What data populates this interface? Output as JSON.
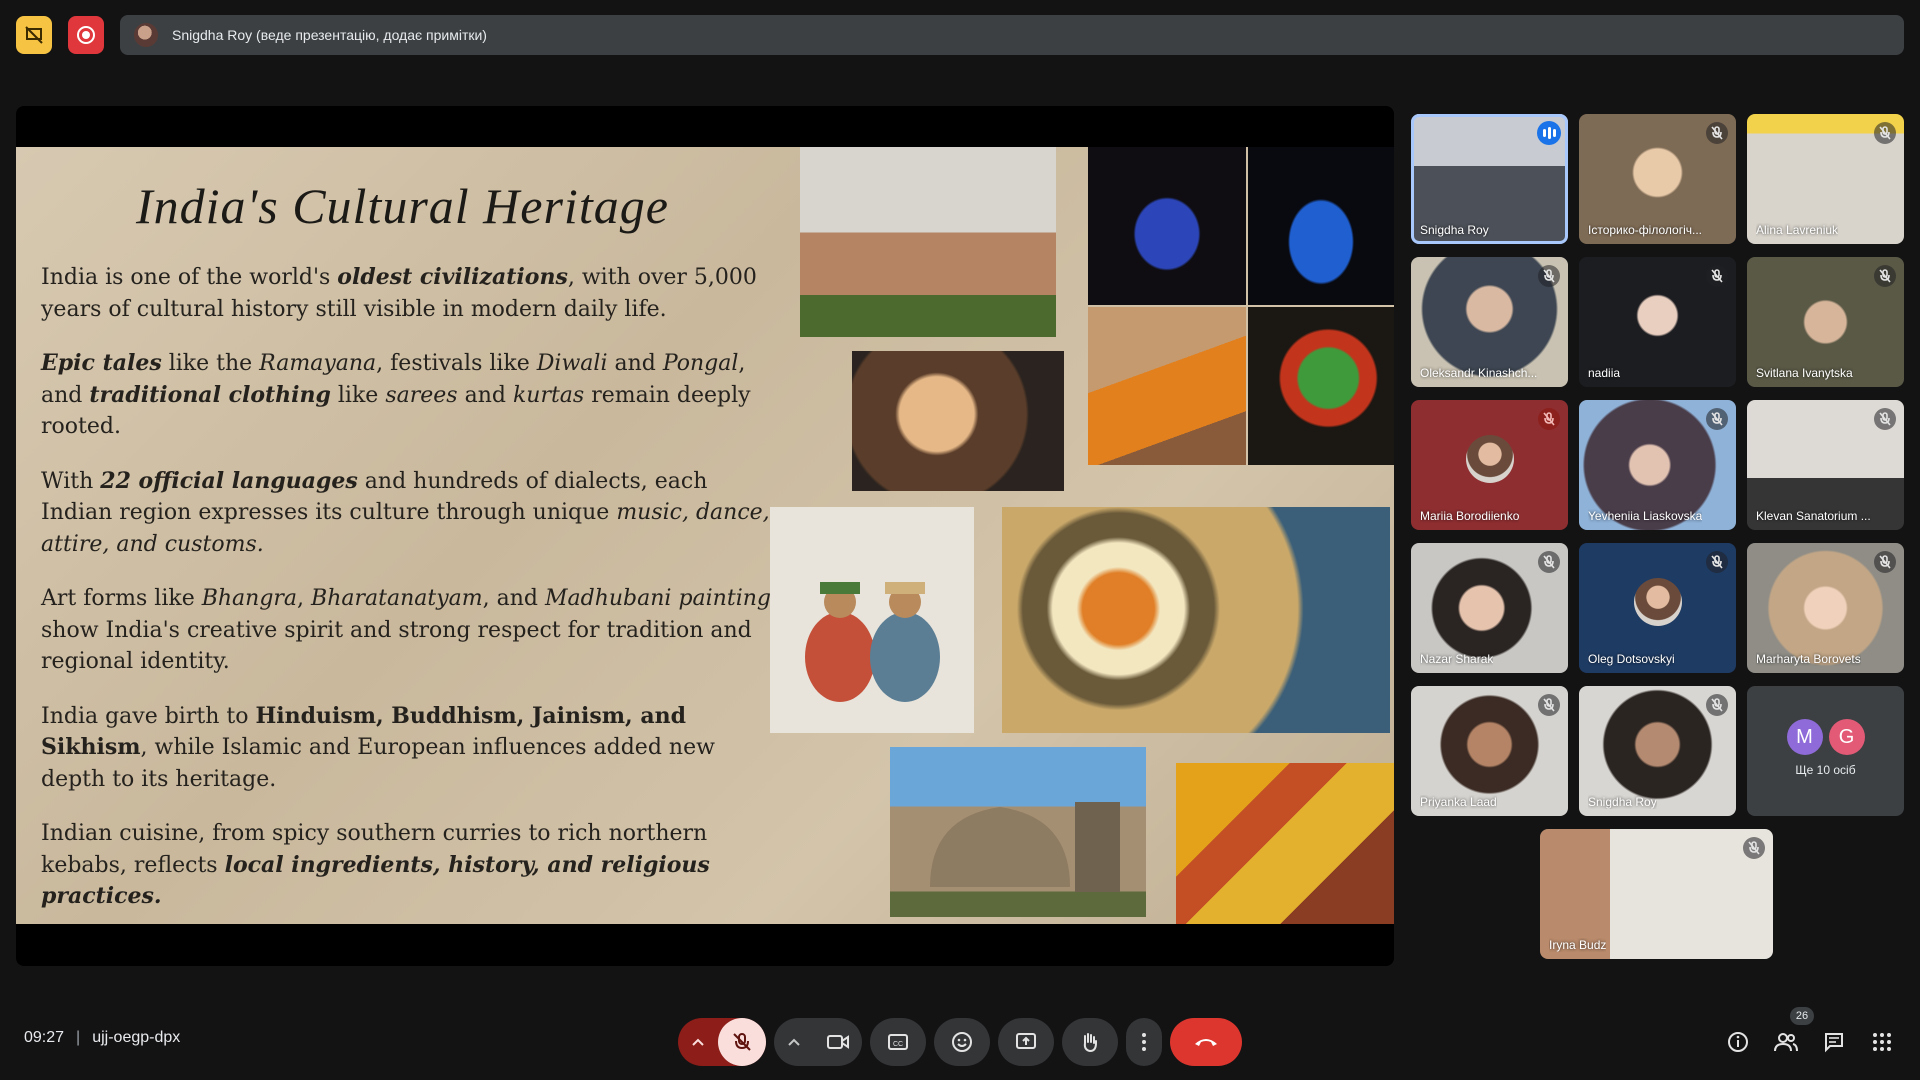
{
  "presenter_bar": {
    "text": "Snigdha Roy (веде презентацію, додає примітки)"
  },
  "slide": {
    "title": "India's Cultural Heritage",
    "paragraphs": [
      "India is one of the world's <i><b>oldest civilizations</b></i>, with over 5,000 years of cultural history still visible in modern daily life.",
      "<i><b>Epic tales</b></i> like the <i>Ramayana</i>, festivals like <i>Diwali</i> and <i>Pongal</i>, and <i><b>traditional clothing</b></i> like <i>sarees</i> and <i>kurtas</i> remain deeply rooted.",
      "With <i><b>22 official languages</b></i> and hundreds of dialects, each Indian region expresses its culture through unique <i>music, dance, attire, and customs.</i>",
      "Art forms like <i>Bhangra</i>, <i>Bharatanatyam</i>, and <i>Madhubani painting</i> show India's creative spirit and strong respect for tradition and regional identity.",
      "India gave birth to <b>Hinduism, Buddhism, Jainism, and Sikhism</b>, while Islamic and European influences added new depth to its heritage.",
      "Indian cuisine, from spicy southern curries to rich northern kebabs, reflects <i><b>local ingredients, history, and religious practices.</b></i>"
    ]
  },
  "participants": [
    {
      "name": "Snigdha Roy",
      "muted": false,
      "speaking": true,
      "bg": "linear-gradient(180deg,#c8ccd2 0 40%,#4c5058 40% 100%)"
    },
    {
      "name": "Історико-філологіч...",
      "muted": true,
      "bg": "radial-gradient(circle at 50% 45%,#e8c9a8 0 22%,#7e6b55 24% 100%)"
    },
    {
      "name": "Alina Lavreniuk",
      "muted": true,
      "bg": "linear-gradient(180deg,#f2d24a 0 15%,#d8d4cc 15% 100%)"
    },
    {
      "name": "Oleksandr Kinashch...",
      "muted": true,
      "bg": "radial-gradient(circle at 50% 40%,#d9b9a2 0 20%,#3d4652 22% 60%,#c9c2b2 62% 100%)"
    },
    {
      "name": "nadiia",
      "muted": true,
      "bg": "radial-gradient(circle at 50% 45%,#e9cfc0 0 18%,#1c1d21 20% 100%)"
    },
    {
      "name": "Svitlana Ivanytska",
      "muted": true,
      "bg": "radial-gradient(circle at 50% 50%,#d6b59a 0 20%,#5a5946 22% 100%)"
    },
    {
      "name": "Mariia Borodiienko",
      "muted": true,
      "muted_red": true,
      "avatar": true,
      "bg": "#8e2e31"
    },
    {
      "name": "Yevheniia Liaskovska",
      "muted": true,
      "bg": "radial-gradient(circle at 45% 50%,#e2c3b2 0 18%,#4a3d4a 20% 60%,#8fb2d8 62% 100%)"
    },
    {
      "name": "Klevan Sanatorium ...",
      "muted": true,
      "bg": "linear-gradient(180deg,#ddd9d4 0 60%,#363535 60% 100%)"
    },
    {
      "name": "Nazar Sharak",
      "muted": true,
      "bg": "radial-gradient(circle at 45% 50%,#e6c3ad 0 20%,#2a2523 22% 45%,#c8c7c4 47% 100%)"
    },
    {
      "name": "Oleg Dotsovskyi",
      "muted": true,
      "avatar": true,
      "bg": "#1e3b64"
    },
    {
      "name": "Marharyta Borovets",
      "muted": true,
      "bg": "radial-gradient(circle at 50% 50%,#f0d2bc 0 20%,#c2a686 22% 55%,#8f8d86 57% 100%)"
    },
    {
      "name": "Priyanka Laad",
      "muted": true,
      "bg": "radial-gradient(circle at 50% 45%,#b58466 0 20%,#3b2b24 22% 45%,#d5d3cf 47% 100%)"
    },
    {
      "name": "Snigdha Roy",
      "muted": true,
      "bg": "radial-gradient(circle at 50% 45%,#b48a70 0 20%,#2b2522 22% 50%,#d8d6d2 52% 100%)"
    },
    {
      "name": "Iryna Budz",
      "muted": true,
      "bg": "linear-gradient(90deg,#b98a6b 0 30%,#e7e3dd 30% 100%)"
    }
  ],
  "more_tile": {
    "initials": [
      "M",
      "G"
    ],
    "label": "Ще 10 осіб",
    "colors": [
      "#8e6bd8",
      "#e25a76"
    ]
  },
  "bottom": {
    "time": "09:27",
    "separator": "|",
    "meeting_code": "ujj-oegp-dpx",
    "participants_count": "26"
  }
}
